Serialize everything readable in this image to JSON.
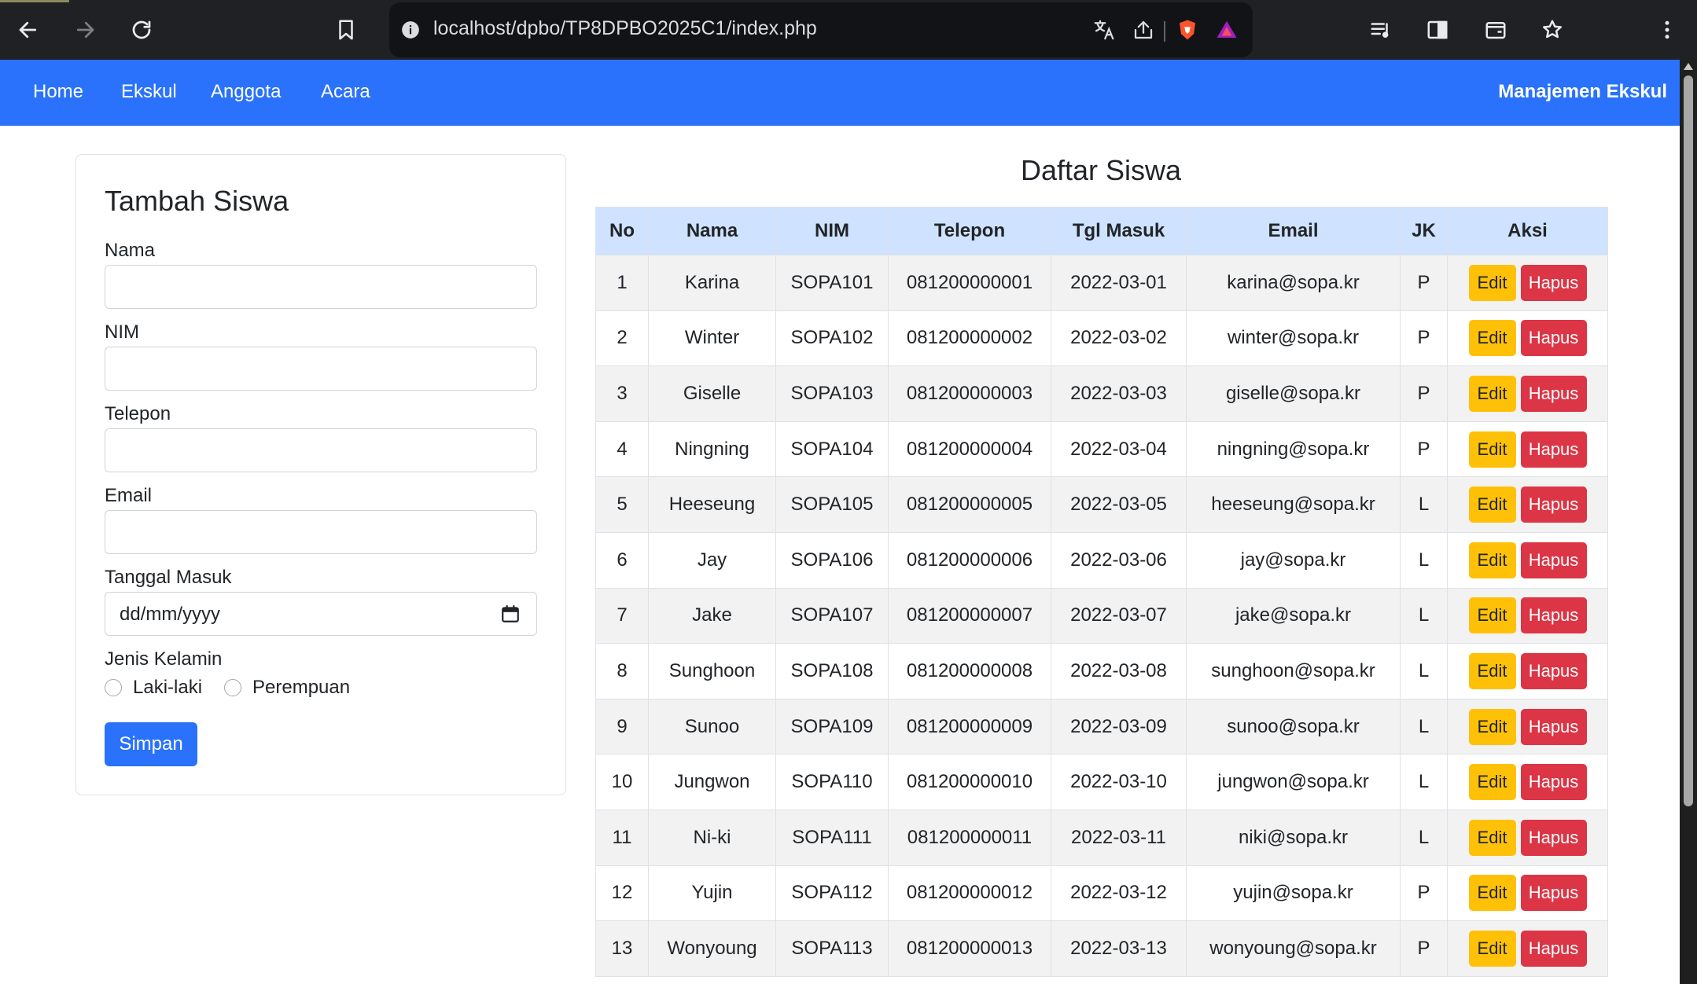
{
  "browser": {
    "url": "localhost/dpbo/TP8DPBO2025C1/index.php"
  },
  "navbar": {
    "links": [
      "Home",
      "Ekskul",
      "Anggota",
      "Acara"
    ],
    "brand": "Manajemen Ekskul",
    "bg_color": "#2a72fb"
  },
  "form": {
    "title": "Tambah Siswa",
    "nama_label": "Nama",
    "nim_label": "NIM",
    "telepon_label": "Telepon",
    "email_label": "Email",
    "tanggal_label": "Tanggal Masuk",
    "tanggal_placeholder": "dd/mm/yyyy",
    "jk_label": "Jenis Kelamin",
    "jk_options": [
      "Laki-laki",
      "Perempuan"
    ],
    "submit_label": "Simpan"
  },
  "table": {
    "title": "Daftar Siswa",
    "headers": [
      "No",
      "Nama",
      "NIM",
      "Telepon",
      "Tgl Masuk",
      "Email",
      "JK",
      "Aksi"
    ],
    "edit_label": "Edit",
    "delete_label": "Hapus",
    "rows": [
      [
        "1",
        "Karina",
        "SOPA101",
        "081200000001",
        "2022-03-01",
        "karina@sopa.kr",
        "P"
      ],
      [
        "2",
        "Winter",
        "SOPA102",
        "081200000002",
        "2022-03-02",
        "winter@sopa.kr",
        "P"
      ],
      [
        "3",
        "Giselle",
        "SOPA103",
        "081200000003",
        "2022-03-03",
        "giselle@sopa.kr",
        "P"
      ],
      [
        "4",
        "Ningning",
        "SOPA104",
        "081200000004",
        "2022-03-04",
        "ningning@sopa.kr",
        "P"
      ],
      [
        "5",
        "Heeseung",
        "SOPA105",
        "081200000005",
        "2022-03-05",
        "heeseung@sopa.kr",
        "L"
      ],
      [
        "6",
        "Jay",
        "SOPA106",
        "081200000006",
        "2022-03-06",
        "jay@sopa.kr",
        "L"
      ],
      [
        "7",
        "Jake",
        "SOPA107",
        "081200000007",
        "2022-03-07",
        "jake@sopa.kr",
        "L"
      ],
      [
        "8",
        "Sunghoon",
        "SOPA108",
        "081200000008",
        "2022-03-08",
        "sunghoon@sopa.kr",
        "L"
      ],
      [
        "9",
        "Sunoo",
        "SOPA109",
        "081200000009",
        "2022-03-09",
        "sunoo@sopa.kr",
        "L"
      ],
      [
        "10",
        "Jungwon",
        "SOPA110",
        "081200000010",
        "2022-03-10",
        "jungwon@sopa.kr",
        "L"
      ],
      [
        "11",
        "Ni-ki",
        "SOPA111",
        "081200000011",
        "2022-03-11",
        "niki@sopa.kr",
        "L"
      ],
      [
        "12",
        "Yujin",
        "SOPA112",
        "081200000012",
        "2022-03-12",
        "yujin@sopa.kr",
        "P"
      ],
      [
        "13",
        "Wonyoung",
        "SOPA113",
        "081200000013",
        "2022-03-13",
        "wonyoung@sopa.kr",
        "P"
      ]
    ],
    "header_color": "#cfe2ff",
    "edit_color": "#ffc107",
    "delete_color": "#dc3545"
  }
}
